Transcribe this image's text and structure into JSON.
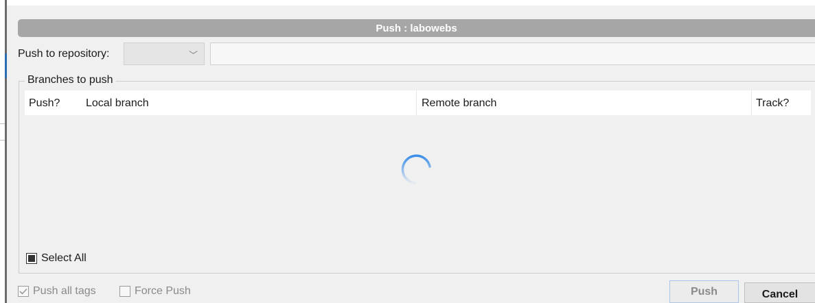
{
  "window": {
    "title": "Push : labowebs"
  },
  "repository": {
    "label": "Push to repository:",
    "selected_value": "",
    "url_value": ""
  },
  "branches_group": {
    "legend": "Branches to push",
    "columns": [
      "Push?",
      "Local branch",
      "Remote branch",
      "Track?"
    ],
    "rows": [],
    "loading": true
  },
  "select_all": {
    "label": "Select All",
    "state": "indeterminate"
  },
  "options": {
    "push_all_tags": {
      "label": "Push all tags",
      "checked": true,
      "enabled": false
    },
    "force_push": {
      "label": "Force Push",
      "checked": false,
      "enabled": false
    }
  },
  "buttons": {
    "push": "Push",
    "cancel": "Cancel"
  },
  "icons": {
    "combo_arrow": "chevron-down-icon",
    "loading": "spinner-icon"
  },
  "colors": {
    "title_bar": "#a6a6a6",
    "accent": "#2b6cb0",
    "spinner": "#3b8ee8"
  }
}
